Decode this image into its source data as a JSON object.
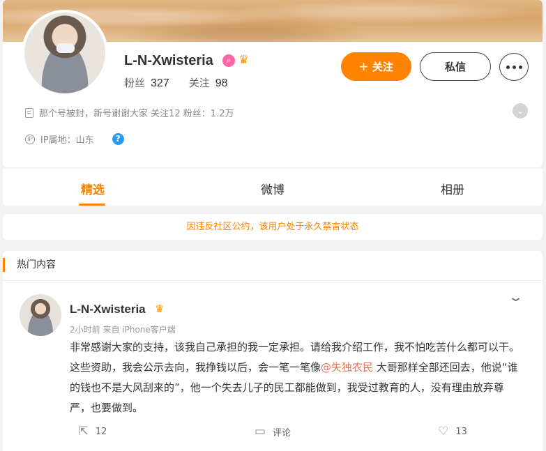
{
  "profile": {
    "nickname": "L-N-Xwisteria",
    "fans_label": "粉丝",
    "fans_count": "327",
    "following_label": "关注",
    "following_count": "98",
    "follow_button": "关注",
    "message_button": "私信",
    "bio": "那个号被封，新号谢谢大家 关注12 粉丝：1.2万",
    "ip_location": "IP属地：山东",
    "icons": [
      "doc-icon",
      "ip-icon",
      "help-icon",
      "expand-icon",
      "verified-badge-icon",
      "crown-icon",
      "more-icon",
      "plus-icon"
    ]
  },
  "tabs": [
    {
      "label": "精选",
      "active": true
    },
    {
      "label": "微博",
      "active": false
    },
    {
      "label": "相册",
      "active": false
    }
  ],
  "notice": "因违反社区公约，该用户处于永久禁言状态",
  "hot": {
    "header": "热门内容",
    "post": {
      "author": "L-N-Xwisteria",
      "meta": "2小时前 来自 iPhone客户端",
      "text_before": "非常感谢大家的支持，该我自己承担的我一定承担。请给我介绍工作，我不怕吃苦什么都可以干。 这些资助，我会公示去向，我挣钱以后，会一笔一笔像",
      "mention": "@失独农民",
      "text_after": " 大哥那样全部还回去，他说“谁的钱也不是大风刮来的”，他一个失去儿子的民工都能做到，我受过教育的人，没有理由放弃尊严，也要做到。",
      "repost_count": "12",
      "comment_label": "评论",
      "like_count": "13"
    }
  },
  "colors": {
    "accent": "#ff8200",
    "mention": "#eb7350",
    "help_blue": "#2a9bf4",
    "badge_pink": "#ff64a4"
  }
}
